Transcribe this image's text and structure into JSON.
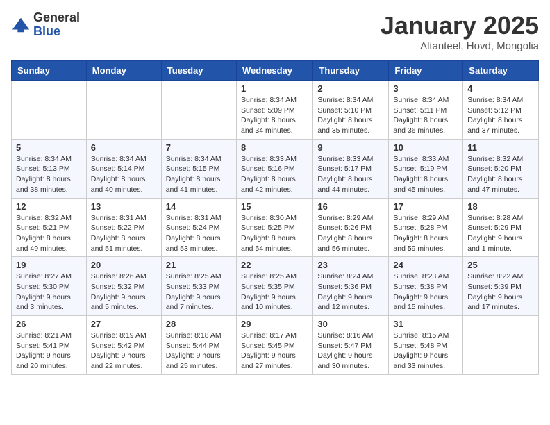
{
  "logo": {
    "general": "General",
    "blue": "Blue"
  },
  "title": "January 2025",
  "subtitle": "Altanteel, Hovd, Mongolia",
  "days_of_week": [
    "Sunday",
    "Monday",
    "Tuesday",
    "Wednesday",
    "Thursday",
    "Friday",
    "Saturday"
  ],
  "weeks": [
    [
      {
        "day": "",
        "info": ""
      },
      {
        "day": "",
        "info": ""
      },
      {
        "day": "",
        "info": ""
      },
      {
        "day": "1",
        "info": "Sunrise: 8:34 AM\nSunset: 5:09 PM\nDaylight: 8 hours\nand 34 minutes."
      },
      {
        "day": "2",
        "info": "Sunrise: 8:34 AM\nSunset: 5:10 PM\nDaylight: 8 hours\nand 35 minutes."
      },
      {
        "day": "3",
        "info": "Sunrise: 8:34 AM\nSunset: 5:11 PM\nDaylight: 8 hours\nand 36 minutes."
      },
      {
        "day": "4",
        "info": "Sunrise: 8:34 AM\nSunset: 5:12 PM\nDaylight: 8 hours\nand 37 minutes."
      }
    ],
    [
      {
        "day": "5",
        "info": "Sunrise: 8:34 AM\nSunset: 5:13 PM\nDaylight: 8 hours\nand 38 minutes."
      },
      {
        "day": "6",
        "info": "Sunrise: 8:34 AM\nSunset: 5:14 PM\nDaylight: 8 hours\nand 40 minutes."
      },
      {
        "day": "7",
        "info": "Sunrise: 8:34 AM\nSunset: 5:15 PM\nDaylight: 8 hours\nand 41 minutes."
      },
      {
        "day": "8",
        "info": "Sunrise: 8:33 AM\nSunset: 5:16 PM\nDaylight: 8 hours\nand 42 minutes."
      },
      {
        "day": "9",
        "info": "Sunrise: 8:33 AM\nSunset: 5:17 PM\nDaylight: 8 hours\nand 44 minutes."
      },
      {
        "day": "10",
        "info": "Sunrise: 8:33 AM\nSunset: 5:19 PM\nDaylight: 8 hours\nand 45 minutes."
      },
      {
        "day": "11",
        "info": "Sunrise: 8:32 AM\nSunset: 5:20 PM\nDaylight: 8 hours\nand 47 minutes."
      }
    ],
    [
      {
        "day": "12",
        "info": "Sunrise: 8:32 AM\nSunset: 5:21 PM\nDaylight: 8 hours\nand 49 minutes."
      },
      {
        "day": "13",
        "info": "Sunrise: 8:31 AM\nSunset: 5:22 PM\nDaylight: 8 hours\nand 51 minutes."
      },
      {
        "day": "14",
        "info": "Sunrise: 8:31 AM\nSunset: 5:24 PM\nDaylight: 8 hours\nand 53 minutes."
      },
      {
        "day": "15",
        "info": "Sunrise: 8:30 AM\nSunset: 5:25 PM\nDaylight: 8 hours\nand 54 minutes."
      },
      {
        "day": "16",
        "info": "Sunrise: 8:29 AM\nSunset: 5:26 PM\nDaylight: 8 hours\nand 56 minutes."
      },
      {
        "day": "17",
        "info": "Sunrise: 8:29 AM\nSunset: 5:28 PM\nDaylight: 8 hours\nand 59 minutes."
      },
      {
        "day": "18",
        "info": "Sunrise: 8:28 AM\nSunset: 5:29 PM\nDaylight: 9 hours\nand 1 minute."
      }
    ],
    [
      {
        "day": "19",
        "info": "Sunrise: 8:27 AM\nSunset: 5:30 PM\nDaylight: 9 hours\nand 3 minutes."
      },
      {
        "day": "20",
        "info": "Sunrise: 8:26 AM\nSunset: 5:32 PM\nDaylight: 9 hours\nand 5 minutes."
      },
      {
        "day": "21",
        "info": "Sunrise: 8:25 AM\nSunset: 5:33 PM\nDaylight: 9 hours\nand 7 minutes."
      },
      {
        "day": "22",
        "info": "Sunrise: 8:25 AM\nSunset: 5:35 PM\nDaylight: 9 hours\nand 10 minutes."
      },
      {
        "day": "23",
        "info": "Sunrise: 8:24 AM\nSunset: 5:36 PM\nDaylight: 9 hours\nand 12 minutes."
      },
      {
        "day": "24",
        "info": "Sunrise: 8:23 AM\nSunset: 5:38 PM\nDaylight: 9 hours\nand 15 minutes."
      },
      {
        "day": "25",
        "info": "Sunrise: 8:22 AM\nSunset: 5:39 PM\nDaylight: 9 hours\nand 17 minutes."
      }
    ],
    [
      {
        "day": "26",
        "info": "Sunrise: 8:21 AM\nSunset: 5:41 PM\nDaylight: 9 hours\nand 20 minutes."
      },
      {
        "day": "27",
        "info": "Sunrise: 8:19 AM\nSunset: 5:42 PM\nDaylight: 9 hours\nand 22 minutes."
      },
      {
        "day": "28",
        "info": "Sunrise: 8:18 AM\nSunset: 5:44 PM\nDaylight: 9 hours\nand 25 minutes."
      },
      {
        "day": "29",
        "info": "Sunrise: 8:17 AM\nSunset: 5:45 PM\nDaylight: 9 hours\nand 27 minutes."
      },
      {
        "day": "30",
        "info": "Sunrise: 8:16 AM\nSunset: 5:47 PM\nDaylight: 9 hours\nand 30 minutes."
      },
      {
        "day": "31",
        "info": "Sunrise: 8:15 AM\nSunset: 5:48 PM\nDaylight: 9 hours\nand 33 minutes."
      },
      {
        "day": "",
        "info": ""
      }
    ]
  ]
}
